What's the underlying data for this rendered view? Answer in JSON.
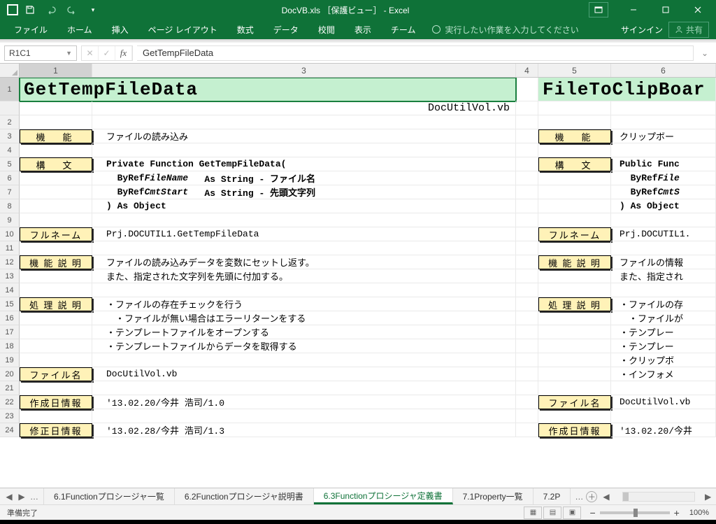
{
  "app": {
    "title": "DocVB.xls ［保護ビュー］ - Excel",
    "signin": "サインイン",
    "share": "共有"
  },
  "ribbon": {
    "file": "ファイル",
    "home": "ホーム",
    "insert": "挿入",
    "pagelayout": "ページ レイアウト",
    "formulas": "数式",
    "data": "データ",
    "review": "校閲",
    "view": "表示",
    "team": "チーム",
    "tellme": "実行したい作業を入力してください"
  },
  "formula": {
    "namebox": "R1C1",
    "value": "GetTempFileData"
  },
  "columns": [
    "1",
    "3",
    "4",
    "5",
    "6"
  ],
  "sheet": {
    "left": {
      "title": "GetTempFileData",
      "subpath": "DocUtilVol.vb",
      "rows": {
        "r3_label": "機　能",
        "r3_text": "ファイルの読み込み",
        "r5_label": "構　文",
        "r5_text": "Private Function GetTempFileData(",
        "r6_text": "  ByRef FileName   As String - ファイル名",
        "r7_text": "  ByRef CmtStart   As String - 先頭文字列",
        "r8_text": ") As Object",
        "r10_label": "フルネーム",
        "r10_text": "Prj.DOCUTIL1.GetTempFileData",
        "r12_label": "機 能 説 明",
        "r12_text": "ファイルの読み込みデータを変数にセットし返す。",
        "r13_text": "また、指定された文字列を先頭に付加する。",
        "r15_label": "処 理 説 明",
        "r15_text": "・ファイルの存在チェックを行う",
        "r16_text": "　・ファイルが無い場合はエラーリターンをする",
        "r17_text": "・テンプレートファイルをオープンする",
        "r18_text": "・テンプレートファイルからデータを取得する",
        "r20_label": "ファイル名",
        "r20_text": "DocUtilVol.vb",
        "r22_label": "作成日情報",
        "r22_text": "'13.02.20/今井 浩司/1.0",
        "r24_label": "修正日情報",
        "r24_text": "'13.02.28/今井 浩司/1.3"
      }
    },
    "right": {
      "title": "FileToClipBoar",
      "rows": {
        "r3_label": "機　能",
        "r3_text": "クリップボー",
        "r5_label": "構　文",
        "r5_text": "Public Func",
        "r6_text": "  ByRef File",
        "r7_text": "  ByRef CmtS",
        "r8_text": ") As Object",
        "r10_label": "フルネーム",
        "r10_text": "Prj.DOCUTIL1.",
        "r12_label": "機 能 説 明",
        "r12_text": "ファイルの情報",
        "r13_text": "また、指定され",
        "r15_label": "処 理 説 明",
        "r15_text": "・ファイルの存",
        "r16_text": "　・ファイルが",
        "r17_text": "・テンプレー",
        "r18_text": "・テンプレー",
        "r19_text": "・クリップボ",
        "r20_text": "・インフォメ",
        "r22_label": "ファイル名",
        "r22_text": "DocUtilVol.vb",
        "r24_label": "作成日情報",
        "r24_text": "'13.02.20/今井"
      }
    }
  },
  "tabs": {
    "t1": "6.1Functionプロシージャ一覧",
    "t2": "6.2Functionプロシージャ説明書",
    "t3": "6.3Functionプロシージャ定義書",
    "t4": "7.1Property一覧",
    "t5": "7.2P"
  },
  "status": {
    "ready": "準備完了",
    "zoom": "100%"
  }
}
